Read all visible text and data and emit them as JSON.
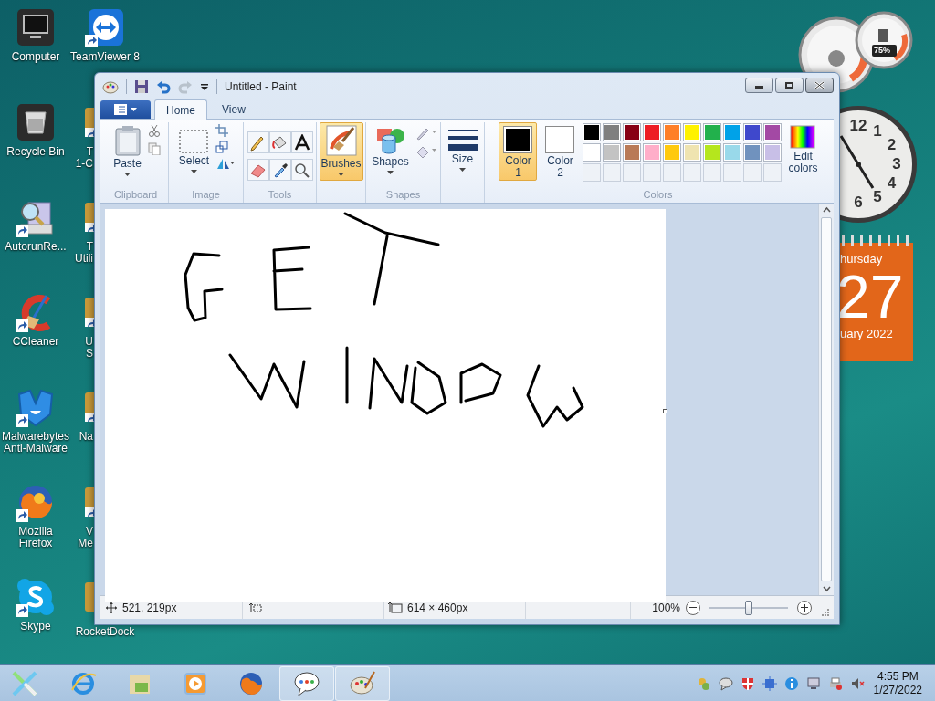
{
  "desktop_columns": [
    {
      "icons": [
        {
          "lines": [
            "Computer"
          ],
          "kind": "monitor",
          "shortcut": false
        },
        {
          "lines": [
            "Recycle Bin"
          ],
          "kind": "bin",
          "shortcut": false
        },
        {
          "lines": [
            "AutorunRe..."
          ],
          "kind": "autorun",
          "shortcut": true
        },
        {
          "lines": [
            "CCleaner"
          ],
          "kind": "ccleaner",
          "shortcut": true
        },
        {
          "lines": [
            "Malwarebytes",
            "Anti-Malware"
          ],
          "kind": "malwarebytes",
          "shortcut": true
        },
        {
          "lines": [
            "Mozilla",
            "Firefox"
          ],
          "kind": "firefox",
          "shortcut": true
        },
        {
          "lines": [
            "Skype"
          ],
          "kind": "skype",
          "shortcut": true
        }
      ]
    },
    {
      "icons": [
        {
          "lines": [
            "TeamViewer 8"
          ],
          "kind": "teamviewer",
          "shortcut": true
        },
        {
          "lines": [
            "T",
            "1-C"
          ],
          "kind": "covered_side",
          "shortcut": true
        },
        {
          "lines": [
            "T",
            "Utili"
          ],
          "kind": "covered_side",
          "shortcut": true
        },
        {
          "lines": [
            "U",
            "S"
          ],
          "kind": "covered_side",
          "shortcut": true
        },
        {
          "lines": [
            "Na"
          ],
          "kind": "covered_side",
          "shortcut": true
        },
        {
          "lines": [
            "V",
            "Me"
          ],
          "kind": "covered_side",
          "shortcut": true
        },
        {
          "lines": [
            "RocketDock"
          ],
          "kind": "covered_top",
          "shortcut": false
        }
      ]
    }
  ],
  "gadgets": {
    "cpu_meter": {
      "reading": "75%"
    },
    "clock": {
      "numerals": [
        "12",
        "1",
        "2",
        "3",
        "4",
        "5",
        "6"
      ]
    },
    "calendar": {
      "weekday": "hursday",
      "day": "27",
      "month_year": "uary 2022"
    }
  },
  "window": {
    "title": "Untitled - Paint",
    "tabs": [
      {
        "label": "Home",
        "selected": true
      },
      {
        "label": "View",
        "selected": false
      }
    ],
    "ribbon": {
      "clipboard": {
        "paste": "Paste",
        "group": "Clipboard"
      },
      "image": {
        "select": "Select",
        "group": "Image"
      },
      "tools": {
        "group": "Tools",
        "items": [
          {
            "kind": "pencil",
            "selected": false
          },
          {
            "kind": "fill",
            "selected": false
          },
          {
            "kind": "text",
            "selected": false
          },
          {
            "kind": "eraser",
            "selected": false
          },
          {
            "kind": "picker",
            "selected": false
          },
          {
            "kind": "magnifier",
            "selected": false
          }
        ]
      },
      "brushes": {
        "label": "Brushes",
        "selected": true
      },
      "shapes": {
        "label": "Shapes",
        "group": "Shapes"
      },
      "size": {
        "label": "Size"
      },
      "color_slots": [
        {
          "label": "Color",
          "number": "1",
          "color": "#000000",
          "selected": true
        },
        {
          "label": "Color",
          "number": "2",
          "color": "#ffffff",
          "selected": false
        }
      ],
      "palette": [
        {
          "color": "#000000"
        },
        {
          "color": "#7f7f7f"
        },
        {
          "color": "#880015"
        },
        {
          "color": "#ed1c24"
        },
        {
          "color": "#ff7f27"
        },
        {
          "color": "#fff200"
        },
        {
          "color": "#22b14c"
        },
        {
          "color": "#00a2e8"
        },
        {
          "color": "#3f48cc"
        },
        {
          "color": "#a349a4"
        },
        {
          "color": "#ffffff"
        },
        {
          "color": "#c3c3c3"
        },
        {
          "color": "#b97a57"
        },
        {
          "color": "#ffaec9"
        },
        {
          "color": "#ffc90e"
        },
        {
          "color": "#efe4b0"
        },
        {
          "color": "#b5e61d"
        },
        {
          "color": "#99d9ea"
        },
        {
          "color": "#7092be"
        },
        {
          "color": "#c8bfe7"
        }
      ],
      "edit_colors": [
        "Edit",
        "colors"
      ],
      "colors_group": "Colors"
    },
    "status_bar": {
      "cursor": "521, 219px",
      "image_size": "614 × 460px",
      "zoom": "100%",
      "zoom_slider": {
        "level": 0.5
      }
    }
  },
  "taskbar": {
    "apps": [
      {
        "kind": "ie",
        "active": false
      },
      {
        "kind": "files",
        "active": false
      },
      {
        "kind": "media",
        "active": false
      },
      {
        "kind": "firefox",
        "active": false
      },
      {
        "kind": "talk",
        "active": true
      },
      {
        "kind": "paint",
        "active": true
      }
    ],
    "tray": [
      {
        "kind": "gadgets"
      },
      {
        "kind": "chat"
      },
      {
        "kind": "shield"
      },
      {
        "kind": "network"
      },
      {
        "kind": "info"
      },
      {
        "kind": "monitor"
      },
      {
        "kind": "printer"
      },
      {
        "kind": "volume"
      }
    ],
    "time": "4:55 PM",
    "date": "1/27/2022"
  }
}
